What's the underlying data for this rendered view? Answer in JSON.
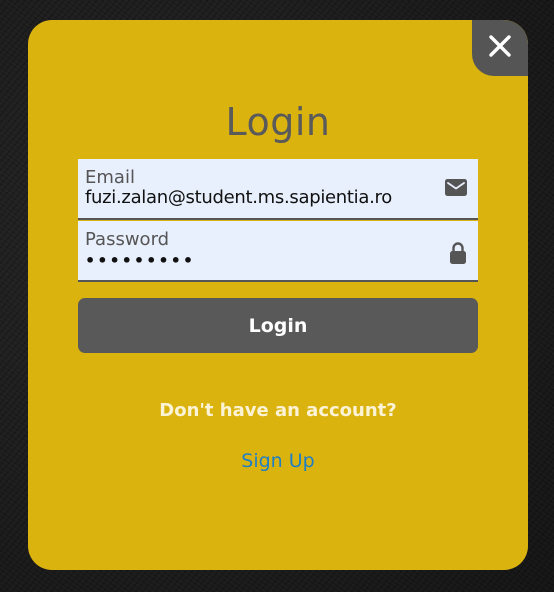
{
  "modal": {
    "title": "Login",
    "background_color": "#dbb30f",
    "close_icon": "close-icon"
  },
  "form": {
    "email": {
      "label": "Email",
      "value": "fuzi.zalan@student.ms.sapientia.ro",
      "icon": "envelope-icon"
    },
    "password": {
      "label": "Password",
      "value": "•••••••••",
      "icon": "lock-icon"
    },
    "submit_label": "Login",
    "submit_color": "#595959"
  },
  "footer": {
    "prompt": "Don't have an account?",
    "signup_label": "Sign Up",
    "signup_color": "#1f7fc4"
  }
}
